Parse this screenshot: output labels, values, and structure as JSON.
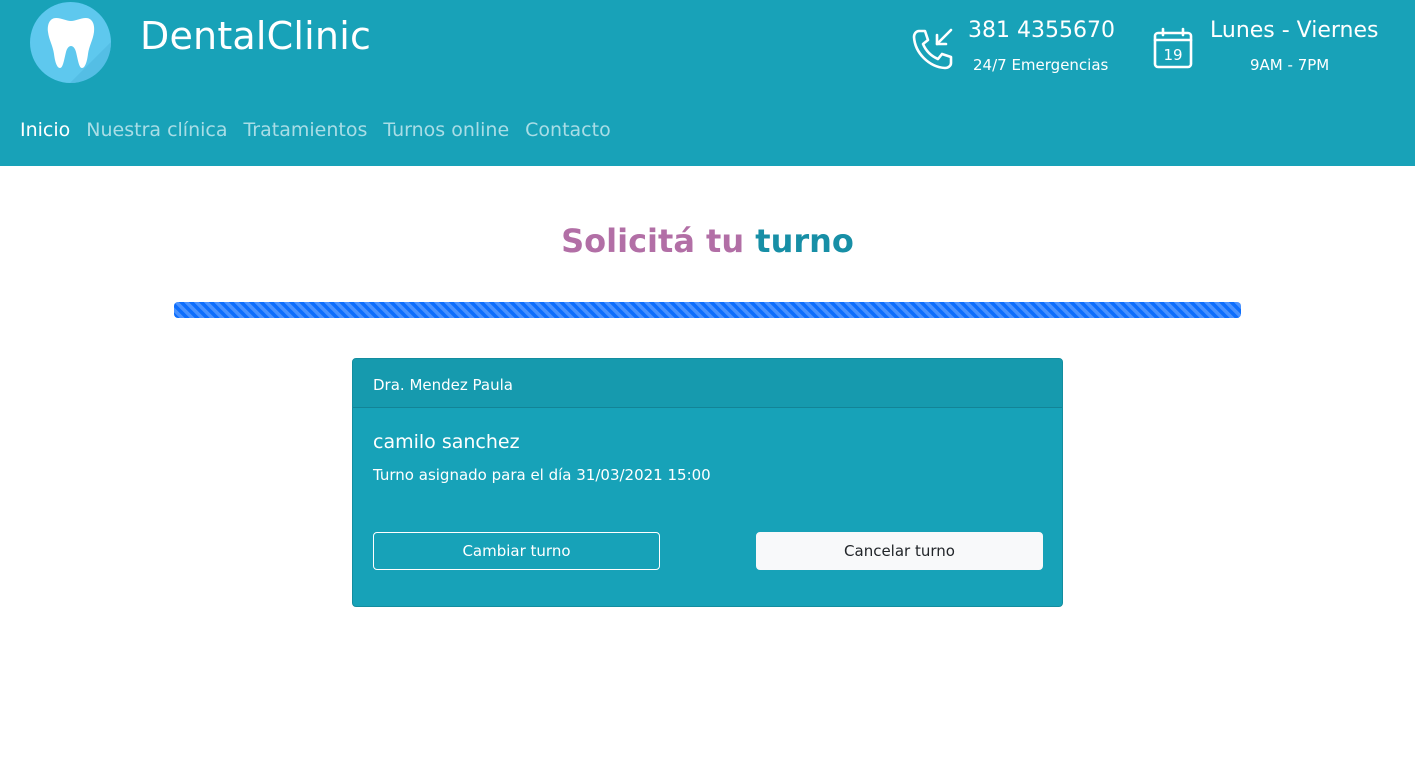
{
  "header": {
    "brand": "DentalClinic",
    "phone": {
      "number": "381 4355670",
      "subtitle": "24/7 Emergencias"
    },
    "schedule": {
      "days": "Lunes - Viernes",
      "hours": "9AM - 7PM",
      "calendar_day": "19"
    }
  },
  "nav": {
    "items": [
      {
        "label": "Inicio",
        "active": true
      },
      {
        "label": "Nuestra clínica",
        "active": false
      },
      {
        "label": "Tratamientos",
        "active": false
      },
      {
        "label": "Turnos online",
        "active": false
      },
      {
        "label": "Contacto",
        "active": false
      }
    ]
  },
  "main": {
    "title_light": "Solicitá tu",
    "title_bold": "turno",
    "progress_percent": 100
  },
  "card": {
    "doctor": "Dra. Mendez Paula",
    "patient": "camilo sanchez",
    "appointment": "Turno asignado para el día 31/03/2021 15:00",
    "change_label": "Cambiar turno",
    "cancel_label": "Cancelar turno"
  },
  "colors": {
    "primary": "#18a2b8",
    "title_accent": "#b26fa6",
    "title_bold": "#178fa6",
    "progress": "#0d6efd"
  },
  "icons": {
    "logo": "tooth-icon",
    "phone": "phone-incoming-icon",
    "calendar": "calendar-icon"
  }
}
